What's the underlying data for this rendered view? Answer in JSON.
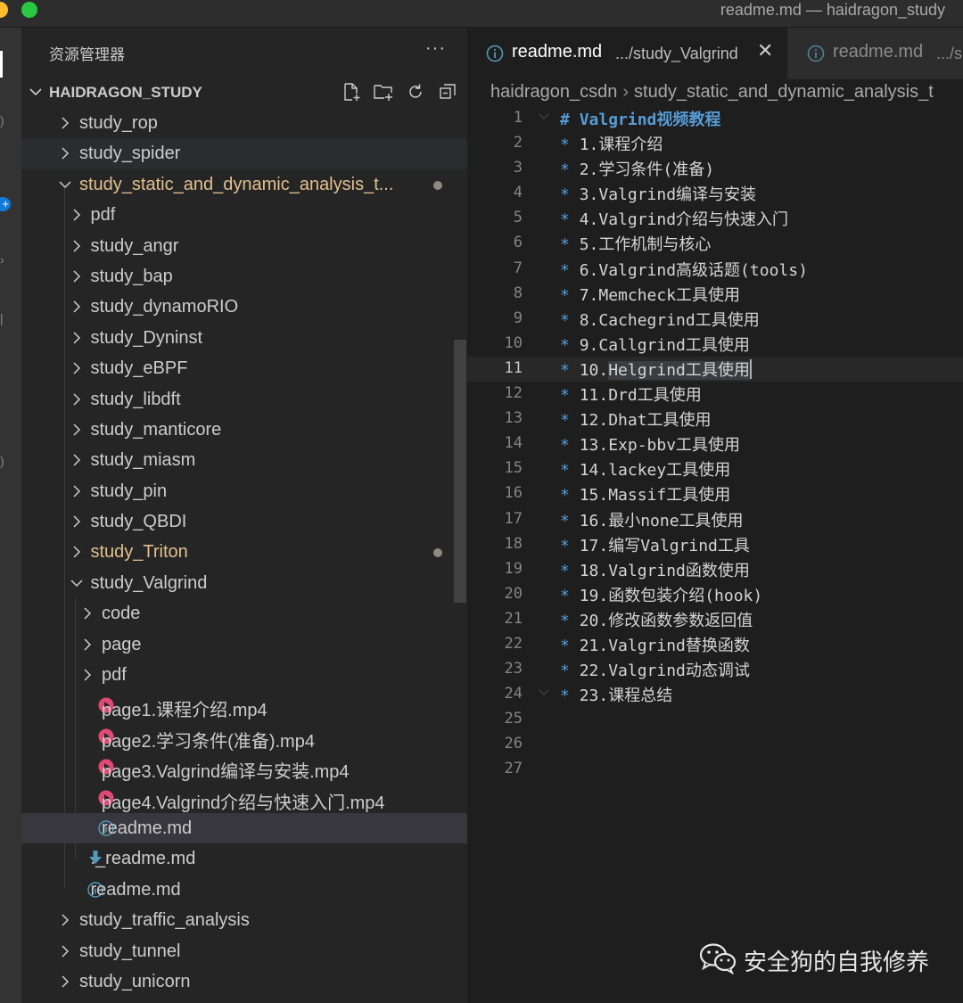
{
  "window": {
    "title": "readme.md — haidragon_study"
  },
  "explorer": {
    "title": "资源管理器",
    "root": "HAIDRAGON_STUDY",
    "items": [
      {
        "label": "study_rop",
        "indent": 0,
        "type": "folder",
        "expanded": false
      },
      {
        "label": "study_spider",
        "indent": 0,
        "type": "folder",
        "expanded": false,
        "state": "hover"
      },
      {
        "label": "study_static_and_dynamic_analysis_t...",
        "indent": 0,
        "type": "folder",
        "expanded": true,
        "modified": true
      },
      {
        "label": "pdf",
        "indent": 1,
        "type": "folder",
        "expanded": false
      },
      {
        "label": "study_angr",
        "indent": 1,
        "type": "folder",
        "expanded": false
      },
      {
        "label": "study_bap",
        "indent": 1,
        "type": "folder",
        "expanded": false
      },
      {
        "label": "study_dynamoRIO",
        "indent": 1,
        "type": "folder",
        "expanded": false
      },
      {
        "label": "study_Dyninst",
        "indent": 1,
        "type": "folder",
        "expanded": false
      },
      {
        "label": "study_eBPF",
        "indent": 1,
        "type": "folder",
        "expanded": false
      },
      {
        "label": "study_libdft",
        "indent": 1,
        "type": "folder",
        "expanded": false
      },
      {
        "label": "study_manticore",
        "indent": 1,
        "type": "folder",
        "expanded": false
      },
      {
        "label": "study_miasm",
        "indent": 1,
        "type": "folder",
        "expanded": false
      },
      {
        "label": "study_pin",
        "indent": 1,
        "type": "folder",
        "expanded": false
      },
      {
        "label": "study_QBDI",
        "indent": 1,
        "type": "folder",
        "expanded": false
      },
      {
        "label": "study_Triton",
        "indent": 1,
        "type": "folder",
        "expanded": false,
        "modified": true
      },
      {
        "label": "study_Valgrind",
        "indent": 1,
        "type": "folder",
        "expanded": true
      },
      {
        "label": "code",
        "indent": 2,
        "type": "folder",
        "expanded": false
      },
      {
        "label": "page",
        "indent": 2,
        "type": "folder",
        "expanded": false
      },
      {
        "label": "pdf",
        "indent": 2,
        "type": "folder",
        "expanded": false
      },
      {
        "label": "page1.课程介绍.mp4",
        "indent": 2,
        "type": "video"
      },
      {
        "label": "page2.学习条件(准备).mp4",
        "indent": 2,
        "type": "video"
      },
      {
        "label": "page3.Valgrind编译与安装.mp4",
        "indent": 2,
        "type": "video"
      },
      {
        "label": "page4.Valgrind介绍与快速入门.mp4",
        "indent": 2,
        "type": "video"
      },
      {
        "label": "readme.md",
        "indent": 2,
        "type": "info",
        "state": "selected"
      },
      {
        "label": "._readme.md",
        "indent": 1,
        "type": "download"
      },
      {
        "label": "readme.md",
        "indent": 1,
        "type": "info"
      },
      {
        "label": "study_traffic_analysis",
        "indent": 0,
        "type": "folder",
        "expanded": false
      },
      {
        "label": "study_tunnel",
        "indent": 0,
        "type": "folder",
        "expanded": false
      },
      {
        "label": "study_unicorn",
        "indent": 0,
        "type": "folder",
        "expanded": false
      }
    ]
  },
  "tabs": [
    {
      "name": "readme.md",
      "path": ".../study_Valgrind",
      "active": true
    },
    {
      "name": "readme.md",
      "path": ".../s",
      "active": false
    }
  ],
  "breadcrumb": [
    "haidragon_csdn",
    "study_static_and_dynamic_analysis_t"
  ],
  "editor": {
    "current_line": 11,
    "lines": [
      {
        "n": "1",
        "marker": "#",
        "text": "Valgrind视频教程",
        "kind": "heading",
        "fold": true
      },
      {
        "n": "2",
        "marker": "*",
        "text": "1.课程介绍"
      },
      {
        "n": "3",
        "marker": "*",
        "text": "2.学习条件(准备)"
      },
      {
        "n": "4",
        "marker": "*",
        "text": "3.Valgrind编译与安装"
      },
      {
        "n": "5",
        "marker": "*",
        "text": "4.Valgrind介绍与快速入门"
      },
      {
        "n": "6",
        "marker": "*",
        "text": "5.工作机制与核心"
      },
      {
        "n": "7",
        "marker": "*",
        "text": "6.Valgrind高级话题(tools)"
      },
      {
        "n": "8",
        "marker": "*",
        "text": "7.Memcheck工具使用"
      },
      {
        "n": "9",
        "marker": "*",
        "text": "8.Cachegrind工具使用"
      },
      {
        "n": "10",
        "marker": "*",
        "text": "9.Callgrind工具使用"
      },
      {
        "n": "11",
        "marker": "*",
        "text": "10.Helgrind工具使用",
        "prefix": "10.",
        "highlight": "Helgrind工具使用"
      },
      {
        "n": "12",
        "marker": "*",
        "text": "11.Drd工具使用"
      },
      {
        "n": "13",
        "marker": "*",
        "text": "12.Dhat工具使用"
      },
      {
        "n": "14",
        "marker": "*",
        "text": "13.Exp-bbv工具使用"
      },
      {
        "n": "15",
        "marker": "*",
        "text": "14.lackey工具使用"
      },
      {
        "n": "16",
        "marker": "*",
        "text": "15.Massif工具使用"
      },
      {
        "n": "17",
        "marker": "*",
        "text": "16.最小none工具使用"
      },
      {
        "n": "18",
        "marker": "*",
        "text": "17.编写Valgrind工具"
      },
      {
        "n": "19",
        "marker": "*",
        "text": "18.Valgrind函数使用"
      },
      {
        "n": "20",
        "marker": "*",
        "text": "19.函数包装介绍(hook)"
      },
      {
        "n": "21",
        "marker": "*",
        "text": "20.修改函数参数返回值"
      },
      {
        "n": "22",
        "marker": "*",
        "text": "21.Valgrind替换函数"
      },
      {
        "n": "23",
        "marker": "*",
        "text": "22.Valgrind动态调试"
      },
      {
        "n": "24",
        "marker": "*",
        "text": "23.课程总结",
        "fold": true
      },
      {
        "n": "25",
        "marker": "",
        "text": ""
      },
      {
        "n": "26",
        "marker": "",
        "text": ""
      },
      {
        "n": "27",
        "marker": "",
        "text": ""
      }
    ]
  },
  "watermark": {
    "text": "安全狗的自我修养"
  },
  "colors": {
    "modified": "#e2c08d",
    "accent": "#569cd6",
    "video_icon": "#e24a76",
    "info_icon": "#519aba"
  }
}
